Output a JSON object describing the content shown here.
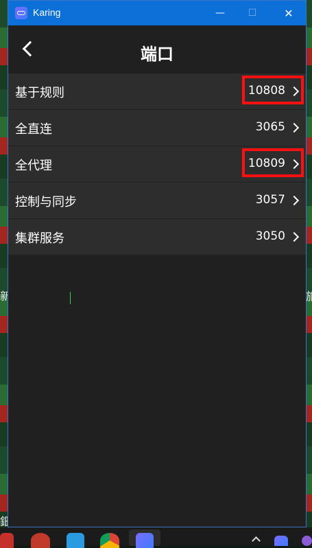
{
  "window": {
    "app_title": "Karing",
    "controls": {
      "minimize": "—",
      "maximize": "☐",
      "close": "✕"
    }
  },
  "header": {
    "title": "端口"
  },
  "rows": [
    {
      "label": "基于规则",
      "value": "10808",
      "highlighted": true
    },
    {
      "label": "全直连",
      "value": "3065",
      "highlighted": false
    },
    {
      "label": "全代理",
      "value": "10809",
      "highlighted": true
    },
    {
      "label": "控制与同步",
      "value": "3057",
      "highlighted": false
    },
    {
      "label": "集群服务",
      "value": "3050",
      "highlighted": false
    }
  ],
  "colors": {
    "titlebar": "#0d6fd8",
    "background": "#202020",
    "row": "#2d2d2d",
    "highlight": "#ff1010"
  },
  "icons": {
    "back": "chevron-left-icon",
    "row_arrow": "chevron-right-icon",
    "app": "karing-app-icon"
  },
  "background_text": {
    "left_1": "新",
    "left_2": "鈿",
    "right_1": "旅"
  }
}
